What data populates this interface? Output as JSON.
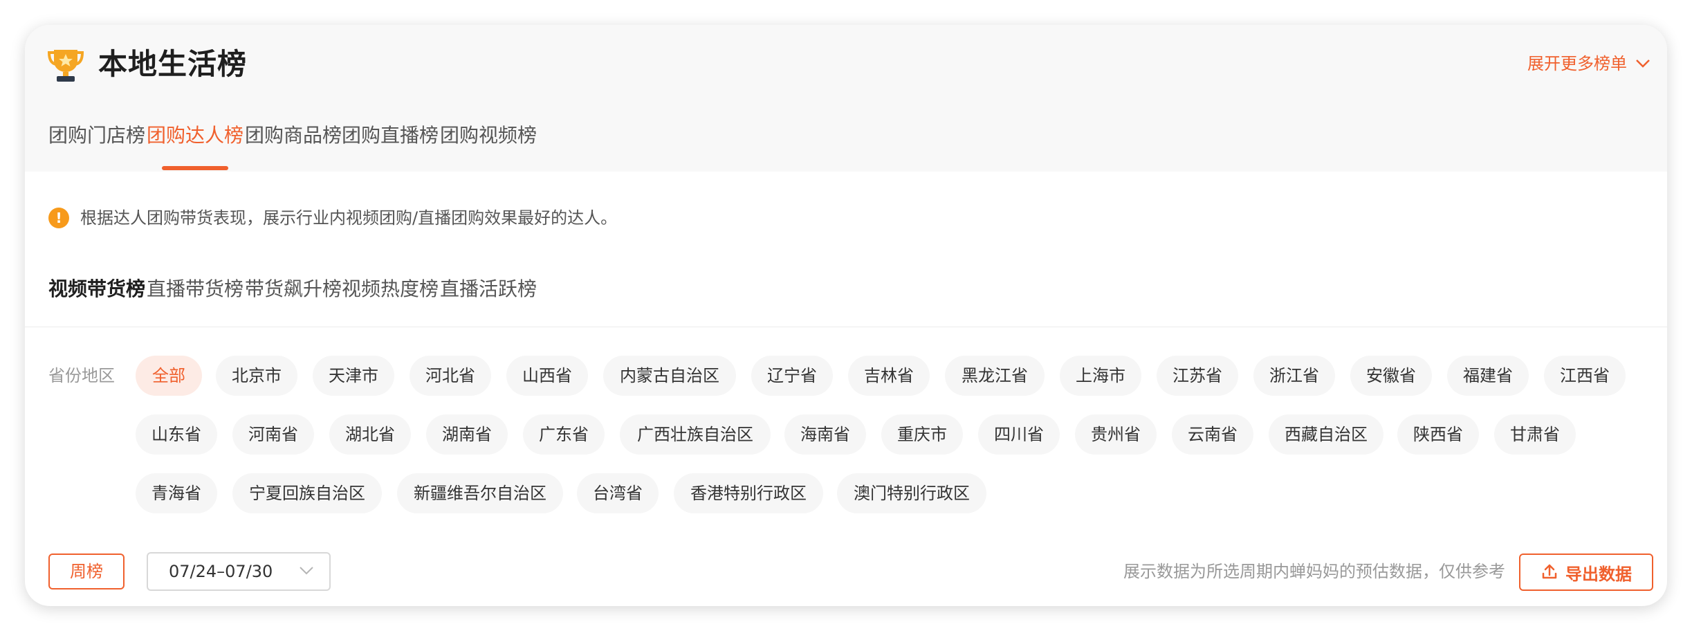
{
  "header": {
    "title": "本地生活榜",
    "expand_label": "展开更多榜单"
  },
  "main_tabs": [
    {
      "label": "团购门店榜",
      "active": false
    },
    {
      "label": "团购达人榜",
      "active": true
    },
    {
      "label": "团购商品榜",
      "active": false
    },
    {
      "label": "团购直播榜",
      "active": false
    },
    {
      "label": "团购视频榜",
      "active": false
    }
  ],
  "notice": "根据达人团购带货表现，展示行业内视频团购/直播团购效果最好的达人。",
  "sub_tabs": [
    {
      "label": "视频带货榜",
      "active": true
    },
    {
      "label": "直播带货榜",
      "active": false
    },
    {
      "label": "带货飙升榜",
      "active": false
    },
    {
      "label": "视频热度榜",
      "active": false
    },
    {
      "label": "直播活跃榜",
      "active": false
    }
  ],
  "region": {
    "label": "省份地区",
    "selected": "全部",
    "rows": [
      [
        "全部",
        "北京市",
        "天津市",
        "河北省",
        "山西省",
        "内蒙古自治区",
        "辽宁省",
        "吉林省",
        "黑龙江省",
        "上海市",
        "江苏省",
        "浙江省",
        "安徽省",
        "福建省",
        "江西省"
      ],
      [
        "山东省",
        "河南省",
        "湖北省",
        "湖南省",
        "广东省",
        "广西壮族自治区",
        "海南省",
        "重庆市",
        "四川省",
        "贵州省",
        "云南省",
        "西藏自治区",
        "陕西省",
        "甘肃省"
      ],
      [
        "青海省",
        "宁夏回族自治区",
        "新疆维吾尔自治区",
        "台湾省",
        "香港特别行政区",
        "澳门特别行政区"
      ]
    ]
  },
  "footer": {
    "period_button": "周榜",
    "date_range": "07/24–07/30",
    "note": "展示数据为所选周期内蝉妈妈的预估数据，仅供参考",
    "export_label": "导出数据"
  },
  "colors": {
    "accent": "#f0602d",
    "chip_bg": "#f6f6f6",
    "chip_active_bg": "#fdebe5",
    "warning": "#f79a1b",
    "trophy": "#f5a623"
  },
  "icons": [
    "trophy-icon",
    "chevron-down-icon",
    "warning-icon",
    "upload-icon"
  ]
}
